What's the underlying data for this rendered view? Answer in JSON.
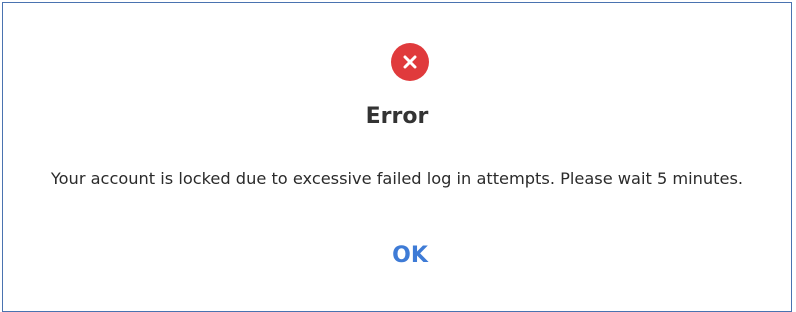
{
  "dialog": {
    "title": "Error",
    "icon": "error-x-circle-icon",
    "icon_color": "#e03a3c",
    "message": "Your account is locked due to excessive failed log in attempts. Please wait 5 minutes.",
    "ok_label": "OK",
    "ok_color": "#3e7bd6",
    "border_color": "#4a73b0"
  }
}
